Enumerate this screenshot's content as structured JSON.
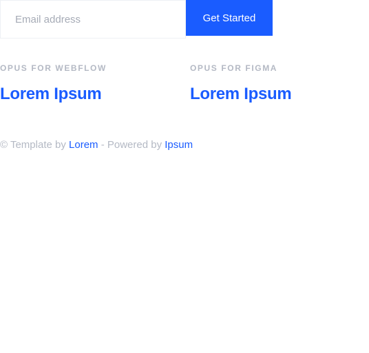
{
  "signup": {
    "email_placeholder": "Email address",
    "email_value": "",
    "button_label": "Get Started"
  },
  "products": [
    {
      "label": "OPUS FOR WEBFLOW",
      "title": "Lorem Ipsum"
    },
    {
      "label": "OPUS FOR FIGMA",
      "title": "Lorem Ipsum"
    }
  ],
  "footer": {
    "copyright_symbol": "©",
    "template_text": " Template by ",
    "template_link": "Lorem",
    "powered_text": " - Powered by ",
    "powered_link": "Ipsum"
  },
  "colors": {
    "accent": "#1a5cff",
    "muted_text": "#b4b9c4",
    "placeholder": "#a6abb6",
    "input_border": "#eef0f4"
  }
}
